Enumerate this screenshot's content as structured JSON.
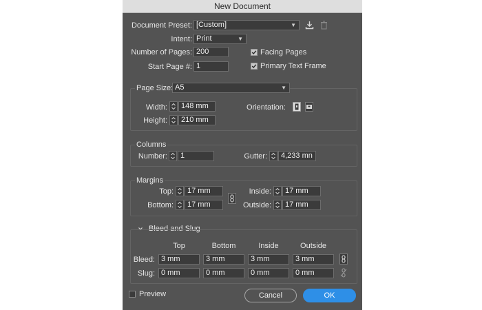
{
  "window": {
    "title": "New Document"
  },
  "preset": {
    "label": "Document Preset:",
    "value": "[Custom]",
    "save_icon": "download-icon",
    "delete_icon": "trash-icon"
  },
  "intent": {
    "label": "Intent:",
    "value": "Print"
  },
  "pages": {
    "label": "Number of Pages:",
    "value": "200"
  },
  "start_page": {
    "label": "Start Page #:",
    "value": "1"
  },
  "facing_pages": {
    "label": "Facing Pages",
    "checked": true
  },
  "primary_text_frame": {
    "label": "Primary Text Frame",
    "checked": true
  },
  "page_size": {
    "label": "Page Size:",
    "value": "A5",
    "width_label": "Width:",
    "width": "148 mm",
    "height_label": "Height:",
    "height": "210 mm",
    "orientation_label": "Orientation:"
  },
  "columns": {
    "title": "Columns",
    "number_label": "Number:",
    "number": "1",
    "gutter_label": "Gutter:",
    "gutter": "4,233 mn"
  },
  "margins": {
    "title": "Margins",
    "top_label": "Top:",
    "top": "17 mm",
    "bottom_label": "Bottom:",
    "bottom": "17 mm",
    "inside_label": "Inside:",
    "inside": "17 mm",
    "outside_label": "Outside:",
    "outside": "17 mm"
  },
  "bleed_slug": {
    "title": "Bleed and Slug",
    "headers": [
      "Top",
      "Bottom",
      "Inside",
      "Outside"
    ],
    "bleed_label": "Bleed:",
    "bleed": [
      "3 mm",
      "3 mm",
      "3 mm",
      "3 mm"
    ],
    "slug_label": "Slug:",
    "slug": [
      "0 mm",
      "0 mm",
      "0 mm",
      "0 mm"
    ]
  },
  "preview": {
    "label": "Preview",
    "checked": false
  },
  "buttons": {
    "cancel": "Cancel",
    "ok": "OK"
  },
  "colors": {
    "dialog_bg": "#535353",
    "field_bg": "#3b3b3b",
    "ok_blue": "#2e8fe7"
  }
}
